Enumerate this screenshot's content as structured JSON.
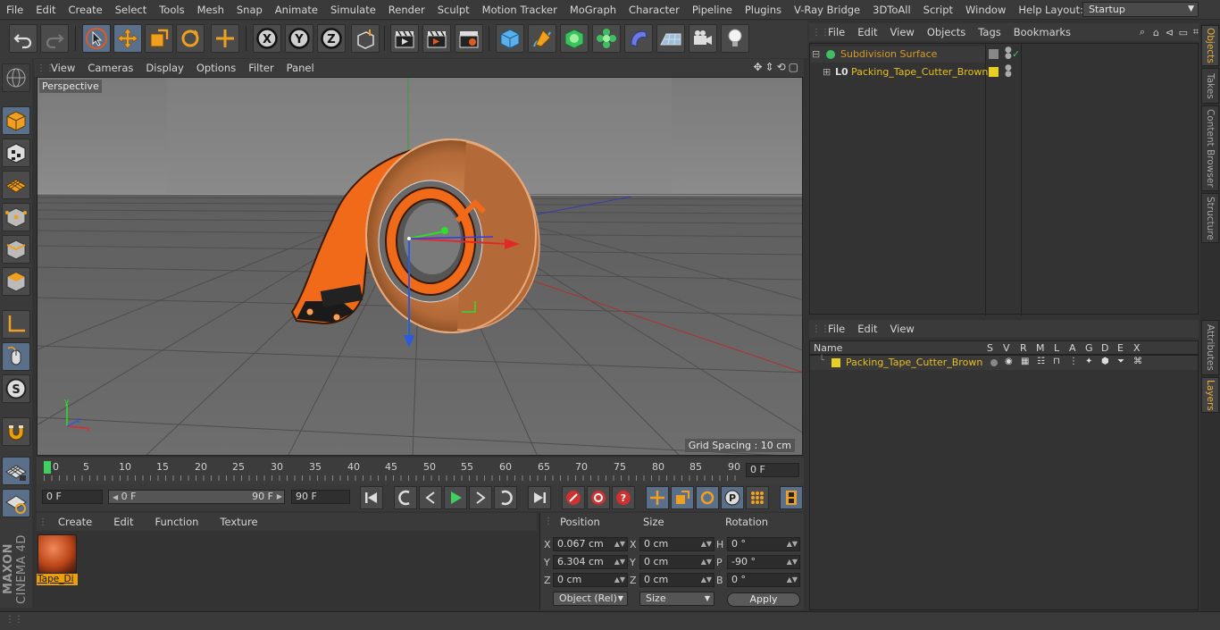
{
  "menubar": {
    "items": [
      "File",
      "Edit",
      "Create",
      "Select",
      "Tools",
      "Mesh",
      "Snap",
      "Animate",
      "Simulate",
      "Render",
      "Sculpt",
      "Motion Tracker",
      "MoGraph",
      "Character",
      "Pipeline",
      "Plugins",
      "V-Ray Bridge",
      "3DToAll",
      "Script",
      "Window",
      "Help"
    ],
    "layout_label": "Layout:",
    "layout_value": "Startup"
  },
  "viewport": {
    "menu": [
      "View",
      "Cameras",
      "Display",
      "Options",
      "Filter",
      "Panel"
    ],
    "label": "Perspective",
    "grid_spacing": "Grid Spacing : 10 cm"
  },
  "timeline": {
    "ticks": [
      "0",
      "5",
      "10",
      "15",
      "20",
      "25",
      "30",
      "35",
      "40",
      "45",
      "50",
      "55",
      "60",
      "65",
      "70",
      "75",
      "80",
      "85",
      "90"
    ],
    "current_frame": "0 F"
  },
  "transport": {
    "start_frame": "0 F",
    "range_start": "0 F",
    "range_end": "90 F",
    "end_frame": "90 F"
  },
  "material_manager": {
    "menu": [
      "Create",
      "Edit",
      "Function",
      "Texture"
    ],
    "material_name": "Tape_Di"
  },
  "coordinates": {
    "headers": {
      "position": "Position",
      "size": "Size",
      "rotation": "Rotation"
    },
    "rows": [
      {
        "axis": "X",
        "pos": "0.067 cm",
        "size_axis": "X",
        "size": "0 cm",
        "rot_axis": "H",
        "rot": "0 °"
      },
      {
        "axis": "Y",
        "pos": "6.304 cm",
        "size_axis": "Y",
        "size": "0 cm",
        "rot_axis": "P",
        "rot": "-90 °"
      },
      {
        "axis": "Z",
        "pos": "0 cm",
        "size_axis": "Z",
        "size": "0 cm",
        "rot_axis": "B",
        "rot": "0 °"
      }
    ],
    "mode": "Object (Rel)",
    "size_mode": "Size",
    "apply": "Apply"
  },
  "object_manager": {
    "menu": [
      "File",
      "Edit",
      "View",
      "Objects",
      "Tags",
      "Bookmarks"
    ],
    "objects": [
      {
        "name": "Subdivision Surface",
        "color": "#d49a2a"
      },
      {
        "name": "Packing_Tape_Cutter_Brown",
        "color": "#e8c020"
      }
    ]
  },
  "layer_manager": {
    "menu": [
      "File",
      "Edit",
      "View"
    ],
    "columns": [
      "Name",
      "S",
      "V",
      "R",
      "M",
      "L",
      "A",
      "G",
      "D",
      "E",
      "X"
    ],
    "layers": [
      {
        "name": "Packing_Tape_Cutter_Brown",
        "color": "#e8c020"
      }
    ]
  },
  "right_tabs": [
    "Objects",
    "Takes",
    "Content Browser",
    "Structure",
    "Attributes",
    "Layers"
  ],
  "logo": {
    "brand": "MAXON",
    "product": "CINEMA 4D"
  },
  "colors": {
    "accent_orange": "#e8a010",
    "object_orange": "#e06a1a",
    "selection_blue": "#5a6f8a"
  }
}
